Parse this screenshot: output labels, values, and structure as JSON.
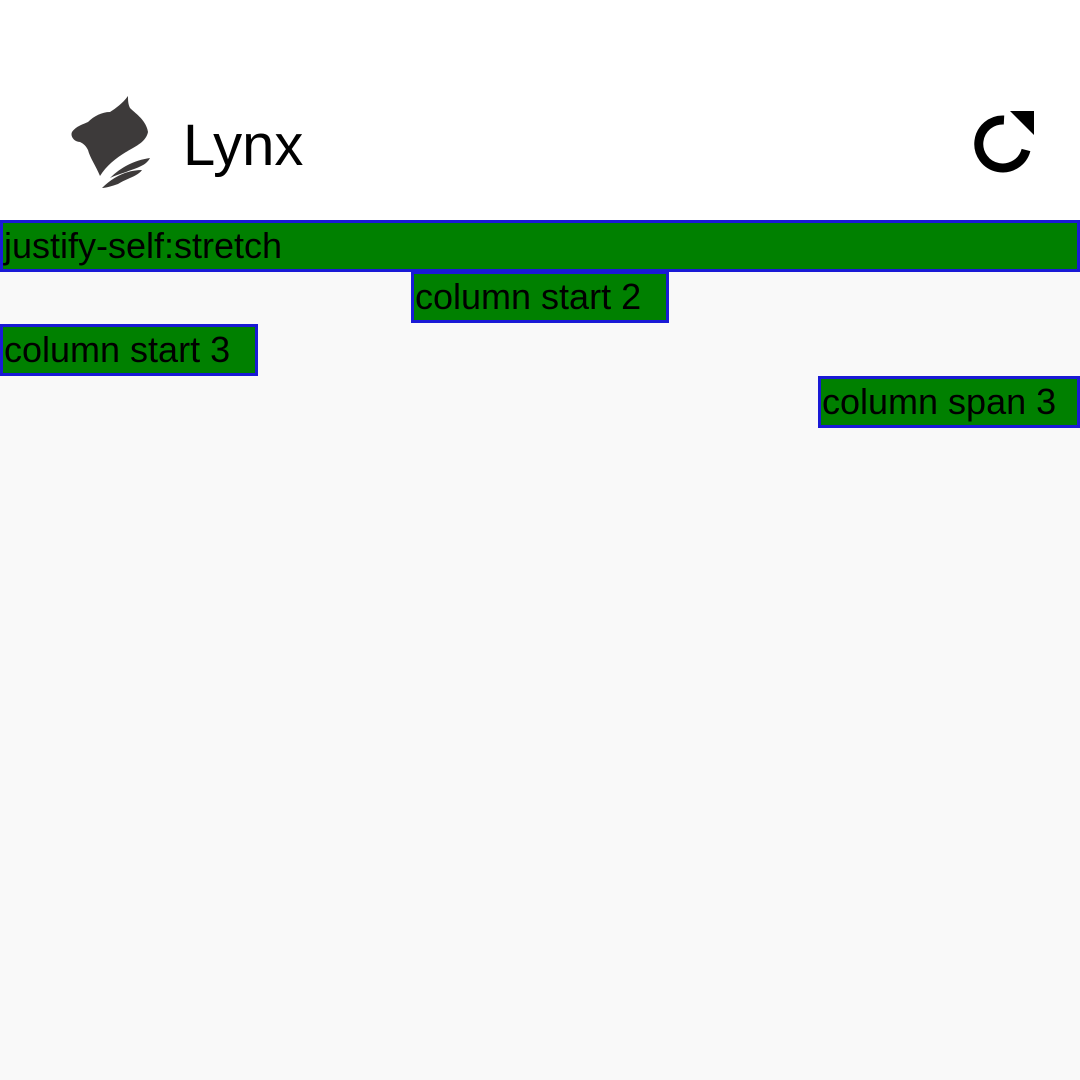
{
  "app_bar": {
    "title": "Lynx",
    "logo_icon": "lynx-cat-logo-icon",
    "reload_icon": "reload-icon"
  },
  "grid": {
    "items": [
      {
        "label": "justify-self:stretch"
      },
      {
        "label": "column start 2"
      },
      {
        "label": "column start 3"
      },
      {
        "label": "column span 3"
      }
    ]
  },
  "colors": {
    "cell_background": "#008000",
    "cell_border": "#1a1ad6",
    "app_bar_background": "#ffffff",
    "page_background": "#f9f9f9"
  }
}
